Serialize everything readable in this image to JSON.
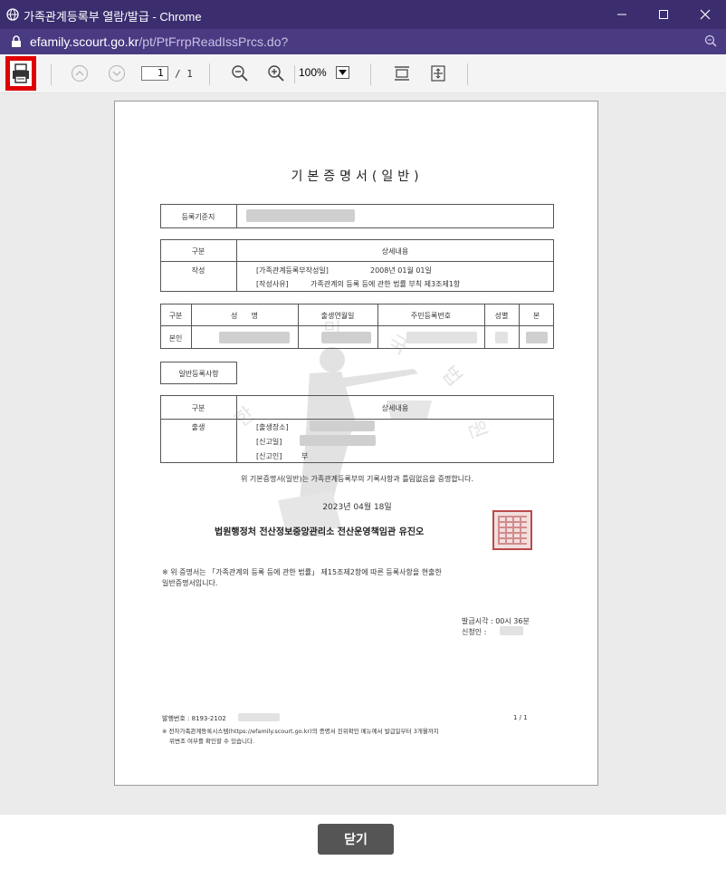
{
  "window": {
    "title": "가족관계등록부 열람/발급 - Chrome",
    "url_host": "efamily.scourt.go.kr",
    "url_path": "/pt/PtFrrpReadIssPrcs.do?"
  },
  "toolbar": {
    "page_current": "1",
    "page_total": "/ 1",
    "zoom": "100%"
  },
  "document": {
    "title": "기본증명서(일반)",
    "registry_label": "등록기준지",
    "section1": {
      "col1": "구분",
      "col2": "상세내용",
      "row_label": "작성",
      "line1_key": "[가족관계등록부작성일]",
      "line1_value": "2008년 01월 01일",
      "line2_key": "[작성사유]",
      "line2_value": "가족관계의 등록 등에 관한 법률 부칙 제3조제1항"
    },
    "person_table": {
      "headers": [
        "구분",
        "성      명",
        "출생연월일",
        "주민등록번호",
        "성별",
        "본"
      ],
      "row_label": "본인"
    },
    "general_label": "일반등록사항",
    "section2": {
      "col1": "구분",
      "col2": "상세내용",
      "row_label": "출생",
      "line1_key": "[출생장소]",
      "line2_key": "[신고일]",
      "line3_key": "[신고인]",
      "line3_value": "부"
    },
    "certify_text": "위 기본증명서(일반)는 가족관계등록부의 기록사항과 틀림없음을 증명합니다.",
    "issue_date": "2023년 04월 18일",
    "issuer": "법원행정처 전산정보중앙관리소 전산운영책임관 유진오",
    "note1": "※ 위 증명서는 「가족관계의 등록 등에 관한 법률」 제15조제2항에 따른 등록사항을 현출한",
    "note2": "일반증명서입니다.",
    "issue_time": "발급시각 : 00시 36분",
    "applicant": "신청인 :",
    "doc_number": "발행번호 : 8193-2102",
    "page_num": "1 / 1",
    "footer1": "※ 전자가족관계등록시스템(https://efamily.scourt.go.kr)의 증명서 진위확인 메뉴에서 발급일부터 3개월까지",
    "footer2": "위변조 여부를 확인할 수 있습니다."
  },
  "buttons": {
    "close": "닫기"
  }
}
